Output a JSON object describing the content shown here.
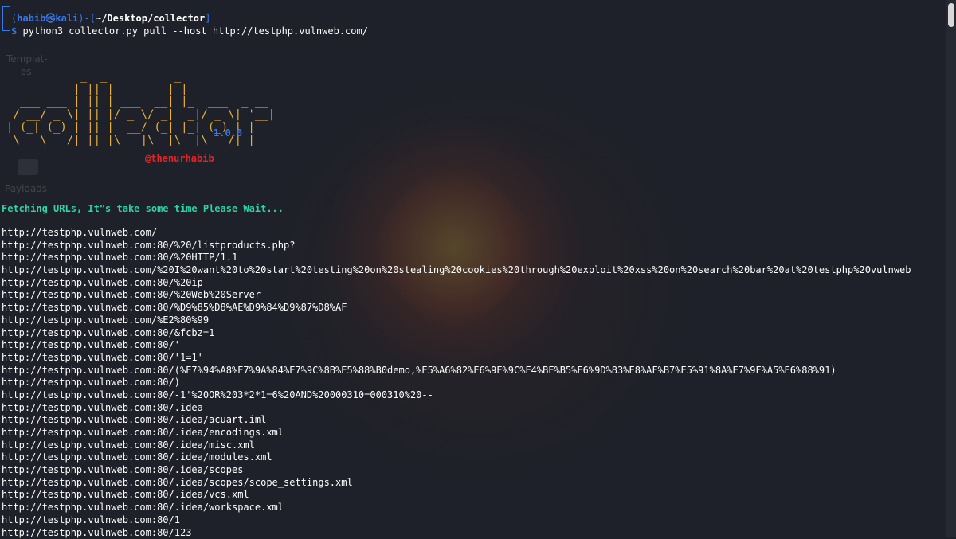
{
  "desktop": {
    "icons": [
      {
        "label": "Templat-"
      },
      {
        "label": "es"
      },
      {
        "label": "Payloads"
      }
    ]
  },
  "terminal": {
    "prompt": {
      "open_paren": "(",
      "user": "habib",
      "at_symbol": "㉿",
      "host": "kali",
      "close_paren": ")",
      "dash_bracket_open": "-[",
      "path": "~/Desktop/collector",
      "bracket_close": "]",
      "dollar": "$",
      "command": "python3 collector.py pull --host http://testphp.vulnweb.com/"
    },
    "banner": {
      "art": "           _  _          _\n          | || |        | |\n  ___ ___ | || | ___  __| |_  ___  _ __\n / __/ _ \\| || |/ _ \\/ _|  _|/ _ \\| '__|\n| (_| (_) | || |  __/ (_| |_| (_) | |\n \\___\\___/|_||_|\\___|\\__|\\__|\\___/|_|",
      "version": "1.0.0",
      "author": "@thenurhabib"
    },
    "status_message": "Fetching URLs, It\"s take some time Please Wait...",
    "urls": [
      "http://testphp.vulnweb.com/",
      "http://testphp.vulnweb.com:80/%20/listproducts.php?",
      "http://testphp.vulnweb.com:80/%20HTTP/1.1",
      "http://testphp.vulnweb.com/%20I%20want%20to%20start%20testing%20on%20stealing%20cookies%20through%20exploit%20xss%20on%20search%20bar%20at%20testphp%20vulnweb",
      "http://testphp.vulnweb.com:80/%20ip",
      "http://testphp.vulnweb.com:80/%20Web%20Server",
      "http://testphp.vulnweb.com:80/%D9%85%D8%AE%D9%84%D9%87%D8%AF",
      "http://testphp.vulnweb.com/%E2%80%99",
      "http://testphp.vulnweb.com:80/&fcbz=1",
      "http://testphp.vulnweb.com:80/'",
      "http://testphp.vulnweb.com:80/'1=1'",
      "http://testphp.vulnweb.com:80/(%E7%94%A8%E7%9A%84%E7%9C%8B%E5%88%B0demo,%E5%A6%82%E6%9E%9C%E4%BE%B5%E6%9D%83%E8%AF%B7%E5%91%8A%E7%9F%A5%E6%88%91)",
      "http://testphp.vulnweb.com:80/)",
      "http://testphp.vulnweb.com:80/-1'%20OR%203*2*1=6%20AND%20000310=000310%20--",
      "http://testphp.vulnweb.com:80/.idea",
      "http://testphp.vulnweb.com:80/.idea/acuart.iml",
      "http://testphp.vulnweb.com:80/.idea/encodings.xml",
      "http://testphp.vulnweb.com:80/.idea/misc.xml",
      "http://testphp.vulnweb.com:80/.idea/modules.xml",
      "http://testphp.vulnweb.com:80/.idea/scopes",
      "http://testphp.vulnweb.com:80/.idea/scopes/scope_settings.xml",
      "http://testphp.vulnweb.com:80/.idea/vcs.xml",
      "http://testphp.vulnweb.com:80/.idea/workspace.xml",
      "http://testphp.vulnweb.com:80/1",
      "http://testphp.vulnweb.com:80/123"
    ]
  },
  "colors": {
    "background": "#1e2129",
    "prompt_blue": "#3a78e8",
    "path_white": "#ffffff",
    "status_green": "#2dd4a8",
    "banner_orange": "#e8b23a",
    "author_red": "#e52424"
  }
}
